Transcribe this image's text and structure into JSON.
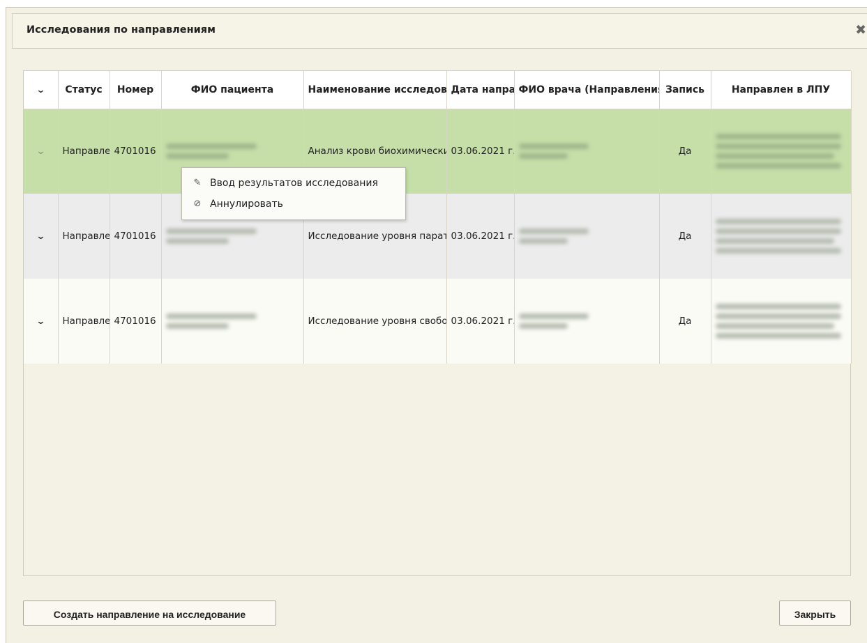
{
  "dialog": {
    "title": "Исследования по направлениям",
    "close_icon": "close-icon"
  },
  "grid": {
    "columns": [
      {
        "key": "expand",
        "label": ""
      },
      {
        "key": "status",
        "label": "Статус"
      },
      {
        "key": "number",
        "label": "Номер"
      },
      {
        "key": "patient",
        "label": "ФИО пациента"
      },
      {
        "key": "study",
        "label": "Наименование исследования"
      },
      {
        "key": "date",
        "label": "Дата направления"
      },
      {
        "key": "doctor",
        "label": "ФИО врача (Направления)"
      },
      {
        "key": "record",
        "label": "Запись"
      },
      {
        "key": "lpu",
        "label": "Направлен в ЛПУ"
      }
    ],
    "rows": [
      {
        "status": "Направлено",
        "number": "4701016",
        "study": "Анализ крови биохимический общетерапевтический",
        "date": "03.06.2021 г.",
        "record": "Да"
      },
      {
        "status": "Направлено",
        "number": "4701016",
        "study": "Исследование уровня паратиреоидного гормона в крови",
        "date": "03.06.2021 г.",
        "record": "Да"
      },
      {
        "status": "Направлено",
        "number": "4701016",
        "study": "Исследование уровня свободного и связанного билирубина в крови",
        "date": "03.06.2021 г.",
        "record": "Да"
      }
    ]
  },
  "context_menu": {
    "items": [
      {
        "label": "Ввод результатов исследования",
        "icon": "pencil-icon"
      },
      {
        "label": "Аннулировать",
        "icon": "cancel-circle-icon"
      }
    ]
  },
  "footer": {
    "create_label": "Создать направление на исследование",
    "close_label": "Закрыть"
  },
  "colors": {
    "selected_row": "#c6dfa9",
    "alt_row": "#ececec",
    "dialog_bg": "#f3f0e4"
  }
}
